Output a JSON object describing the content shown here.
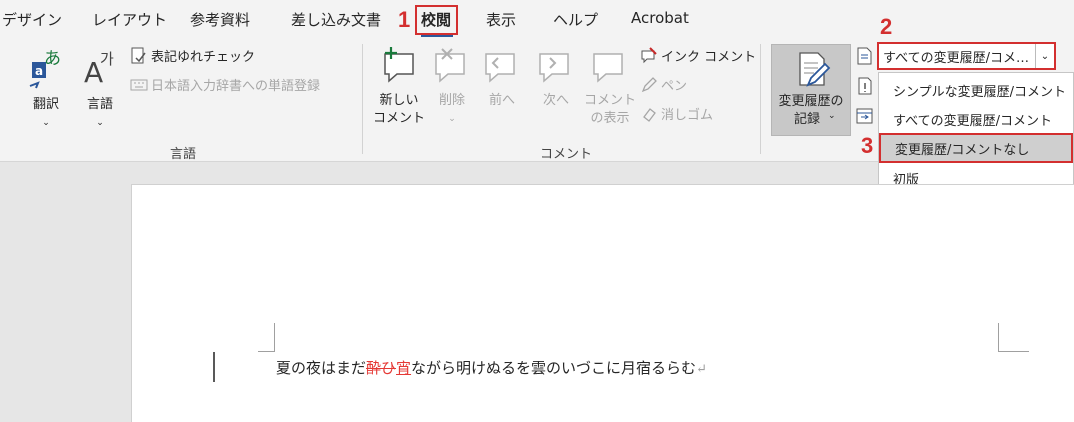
{
  "tabs": {
    "design": "デザイン",
    "layout": "レイアウト",
    "references": "参考資料",
    "mailings": "差し込み文書",
    "review": "校閲",
    "view": "表示",
    "help": "ヘルプ",
    "acrobat": "Acrobat"
  },
  "steps": {
    "one": "1",
    "two": "2",
    "three": "3"
  },
  "language_group": {
    "translate": "翻訳",
    "language": "言語",
    "proofing_check": "表記ゆれチェック",
    "ime_register": "日本語入力辞書への単語登録",
    "label": "言語"
  },
  "comment_group": {
    "new_comment": [
      "新しい",
      "コメント"
    ],
    "delete": "削除",
    "previous": "前へ",
    "next": "次へ",
    "show_comments": [
      "コメント",
      "の表示"
    ],
    "ink_comment": "インク コメント",
    "pen": "ペン",
    "eraser": "消しゴム",
    "label": "コメント"
  },
  "tracking": {
    "track_changes": [
      "変更履歴の",
      "記録"
    ],
    "display_value": "すべての変更履歴/コメ…",
    "options": [
      "シンプルな変更履歴/コメント",
      "すべての変更履歴/コメント",
      "変更履歴/コメントなし",
      "初版"
    ]
  },
  "document": {
    "text_before": "夏の夜はまだ",
    "deleted": "酔ひ",
    "inserted": "宵",
    "text_after": "ながら明けぬるを雲のいづこに月宿るらむ",
    "para_mark": "↵"
  },
  "colors": {
    "accent": "#2b579a",
    "highlight": "#d32f2f",
    "revision": "#e53935"
  }
}
